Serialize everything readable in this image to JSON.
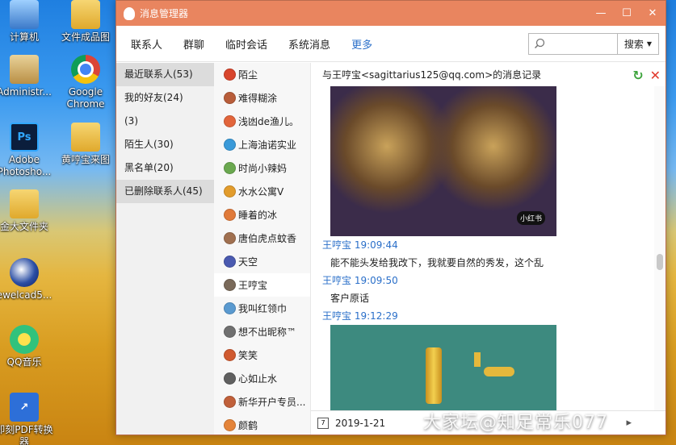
{
  "desktop": {
    "icons": [
      {
        "label": "计算机",
        "name": "desktop-icon-computer"
      },
      {
        "label": "文件成品图",
        "name": "desktop-icon-finished-images"
      },
      {
        "label": "Administr...",
        "name": "desktop-icon-administrator"
      },
      {
        "label": "Google Chrome",
        "name": "desktop-icon-chrome"
      },
      {
        "label": "Adobe Photosho...",
        "name": "desktop-icon-photoshop"
      },
      {
        "label": "黄哼宝来图",
        "name": "desktop-icon-images-folder"
      },
      {
        "label": "金大文件夹",
        "name": "desktop-icon-big-folder"
      },
      {
        "label": "ewelcad5...",
        "name": "desktop-icon-jewelcad"
      },
      {
        "label": "QQ音乐",
        "name": "desktop-icon-qqmusic"
      },
      {
        "label": "即刻PDF转换器",
        "name": "desktop-icon-pdf-converter"
      }
    ]
  },
  "window": {
    "title": "消息管理器",
    "controls": {
      "min": "—",
      "max": "☐",
      "close": "✕"
    },
    "nav": [
      "联系人",
      "群聊",
      "临时会话",
      "系统消息",
      "更多"
    ],
    "search": {
      "value": "",
      "button": "搜索"
    }
  },
  "sidebar": {
    "items": [
      "最近联系人(53)",
      "我的好友(24)",
      "(3)",
      "陌生人(30)",
      "黑名单(20)",
      "已删除联系人(45)"
    ]
  },
  "contacts": {
    "items": [
      "陌尘",
      "难得糊涂",
      "浅凼de渔儿。",
      "上海油诺实业",
      "时尚小辣妈",
      "水水公寓V",
      "睡着的冰",
      "唐伯虎点蚊香",
      "天空",
      "王哼宝",
      "我叫红领巾",
      "想不出昵称™",
      "笑笑",
      "心如止水",
      "新华开户专员...",
      "颜鹤"
    ],
    "avatar_colors": [
      "#d8452c",
      "#b85d3a",
      "#e2653b",
      "#3a9ad9",
      "#6aa84f",
      "#e29c2c",
      "#e07a3a",
      "#a07050",
      "#4a5ab0",
      "#7a6a5a",
      "#5a9ad0",
      "#707070",
      "#d05a30",
      "#606060",
      "#c0603a",
      "#e4843a"
    ]
  },
  "chat": {
    "header": "与王哼宝<sagittarius125@qq.com>的消息记录",
    "image_badge": "小红书",
    "messages": [
      {
        "sender": "王哼宝 19:09:44",
        "text": "能不能头发给我改下，我就要自然的秀发，这个乱"
      },
      {
        "sender": "王哼宝 19:09:50",
        "text": "客户原话"
      },
      {
        "sender": "王哼宝 19:12:29"
      }
    ],
    "date": "2019-1-21",
    "calendar_day": "7"
  },
  "watermark": "大家坛@知足常乐077"
}
